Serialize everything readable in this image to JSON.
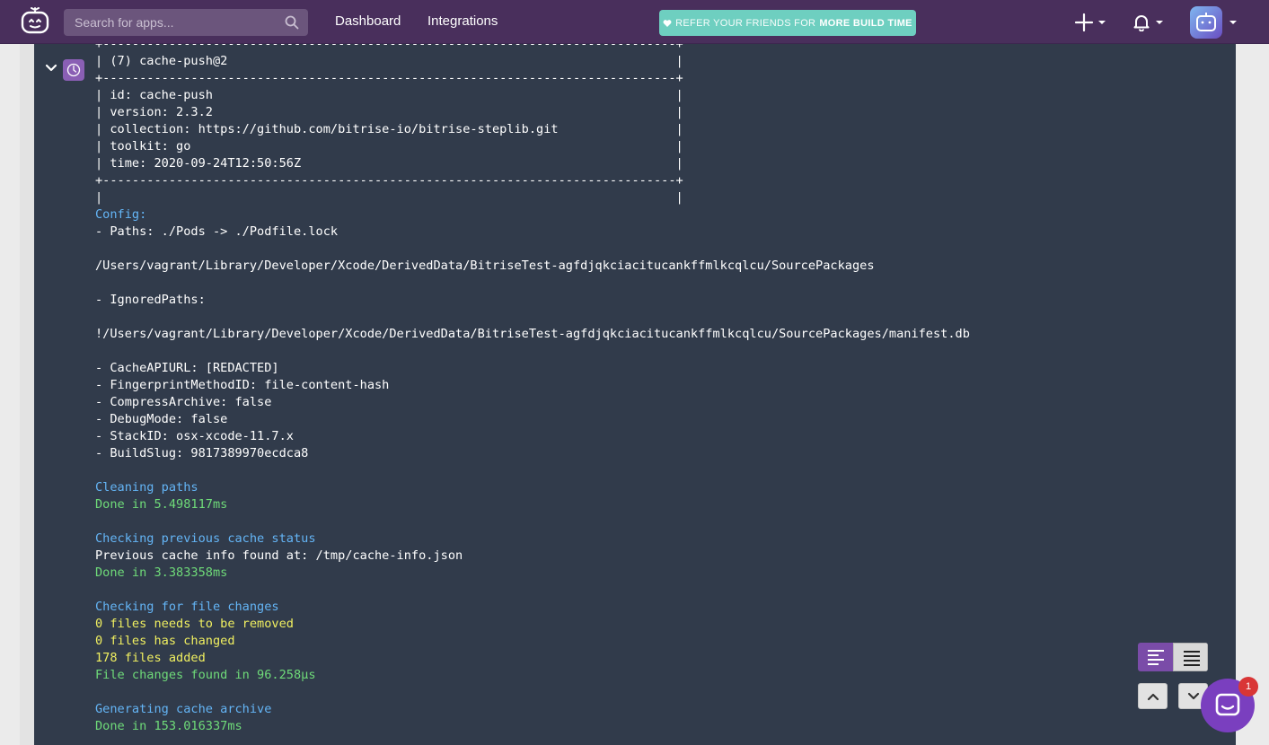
{
  "nav": {
    "search_placeholder": "Search for apps...",
    "links": [
      {
        "label": "Dashboard"
      },
      {
        "label": "Integrations"
      }
    ],
    "refer_prefix": "REFER YOUR FRIENDS FOR",
    "refer_highlight": "MORE BUILD TIME"
  },
  "log": {
    "lines": [
      {
        "text": "+------------------------------------------------------------------------------+",
        "color": "white"
      },
      {
        "text": "| (7) cache-push@2                                                             |",
        "color": "white"
      },
      {
        "text": "+------------------------------------------------------------------------------+",
        "color": "white"
      },
      {
        "text": "| id: cache-push                                                               |",
        "color": "white"
      },
      {
        "text": "| version: 2.3.2                                                               |",
        "color": "white"
      },
      {
        "text": "| collection: https://github.com/bitrise-io/bitrise-steplib.git                |",
        "color": "white"
      },
      {
        "text": "| toolkit: go                                                                  |",
        "color": "white"
      },
      {
        "text": "| time: 2020-09-24T12:50:56Z                                                   |",
        "color": "white"
      },
      {
        "text": "+------------------------------------------------------------------------------+",
        "color": "white"
      },
      {
        "text": "|                                                                              |",
        "color": "white"
      },
      {
        "text": "Config:",
        "color": "blue"
      },
      {
        "text": "- Paths: ./Pods -> ./Podfile.lock",
        "color": "white"
      },
      {
        "text": "",
        "color": "white"
      },
      {
        "text": "/Users/vagrant/Library/Developer/Xcode/DerivedData/BitriseTest-agfdjqkciacitucankffmlkcqlcu/SourcePackages",
        "color": "white"
      },
      {
        "text": "",
        "color": "white"
      },
      {
        "text": "- IgnoredPaths:",
        "color": "white"
      },
      {
        "text": "",
        "color": "white"
      },
      {
        "text": "!/Users/vagrant/Library/Developer/Xcode/DerivedData/BitriseTest-agfdjqkciacitucankffmlkcqlcu/SourcePackages/manifest.db",
        "color": "white"
      },
      {
        "text": "",
        "color": "white"
      },
      {
        "text": "- CacheAPIURL: [REDACTED]",
        "color": "white"
      },
      {
        "text": "- FingerprintMethodID: file-content-hash",
        "color": "white"
      },
      {
        "text": "- CompressArchive: false",
        "color": "white"
      },
      {
        "text": "- DebugMode: false",
        "color": "white"
      },
      {
        "text": "- StackID: osx-xcode-11.7.x",
        "color": "white"
      },
      {
        "text": "- BuildSlug: 9817389970ecdca8",
        "color": "white"
      },
      {
        "text": "",
        "color": "white"
      },
      {
        "text": "Cleaning paths",
        "color": "blue"
      },
      {
        "text": "Done in 5.498117ms",
        "color": "green"
      },
      {
        "text": "",
        "color": "white"
      },
      {
        "text": "Checking previous cache status",
        "color": "blue"
      },
      {
        "text": "Previous cache info found at: /tmp/cache-info.json",
        "color": "white"
      },
      {
        "text": "Done in 3.383358ms",
        "color": "green"
      },
      {
        "text": "",
        "color": "white"
      },
      {
        "text": "Checking for file changes",
        "color": "blue"
      },
      {
        "text": "0 files needs to be removed",
        "color": "yellow"
      },
      {
        "text": "0 files has changed",
        "color": "yellow"
      },
      {
        "text": "178 files added",
        "color": "yellow"
      },
      {
        "text": "File changes found in 96.258µs",
        "color": "green"
      },
      {
        "text": "",
        "color": "white"
      },
      {
        "text": "Generating cache archive",
        "color": "blue"
      },
      {
        "text": "Done in 153.016337ms",
        "color": "green"
      }
    ]
  },
  "chat": {
    "badge_count": "1"
  },
  "colors": {
    "nav_bg": "#492f5c",
    "log_bg": "#313b4b",
    "accent": "#7a4ca8",
    "refer_bg": "#6ecfc0",
    "log_blue": "#64b5f6",
    "log_green": "#6fdb79",
    "log_yellow": "#f1f060"
  },
  "icons": [
    "bitrise-logo-icon",
    "search-icon",
    "plus-icon",
    "bell-icon",
    "chevron-down-icon",
    "step-icon",
    "wrap-lines-icon",
    "full-lines-icon",
    "chevron-up-icon",
    "chat-icon"
  ]
}
